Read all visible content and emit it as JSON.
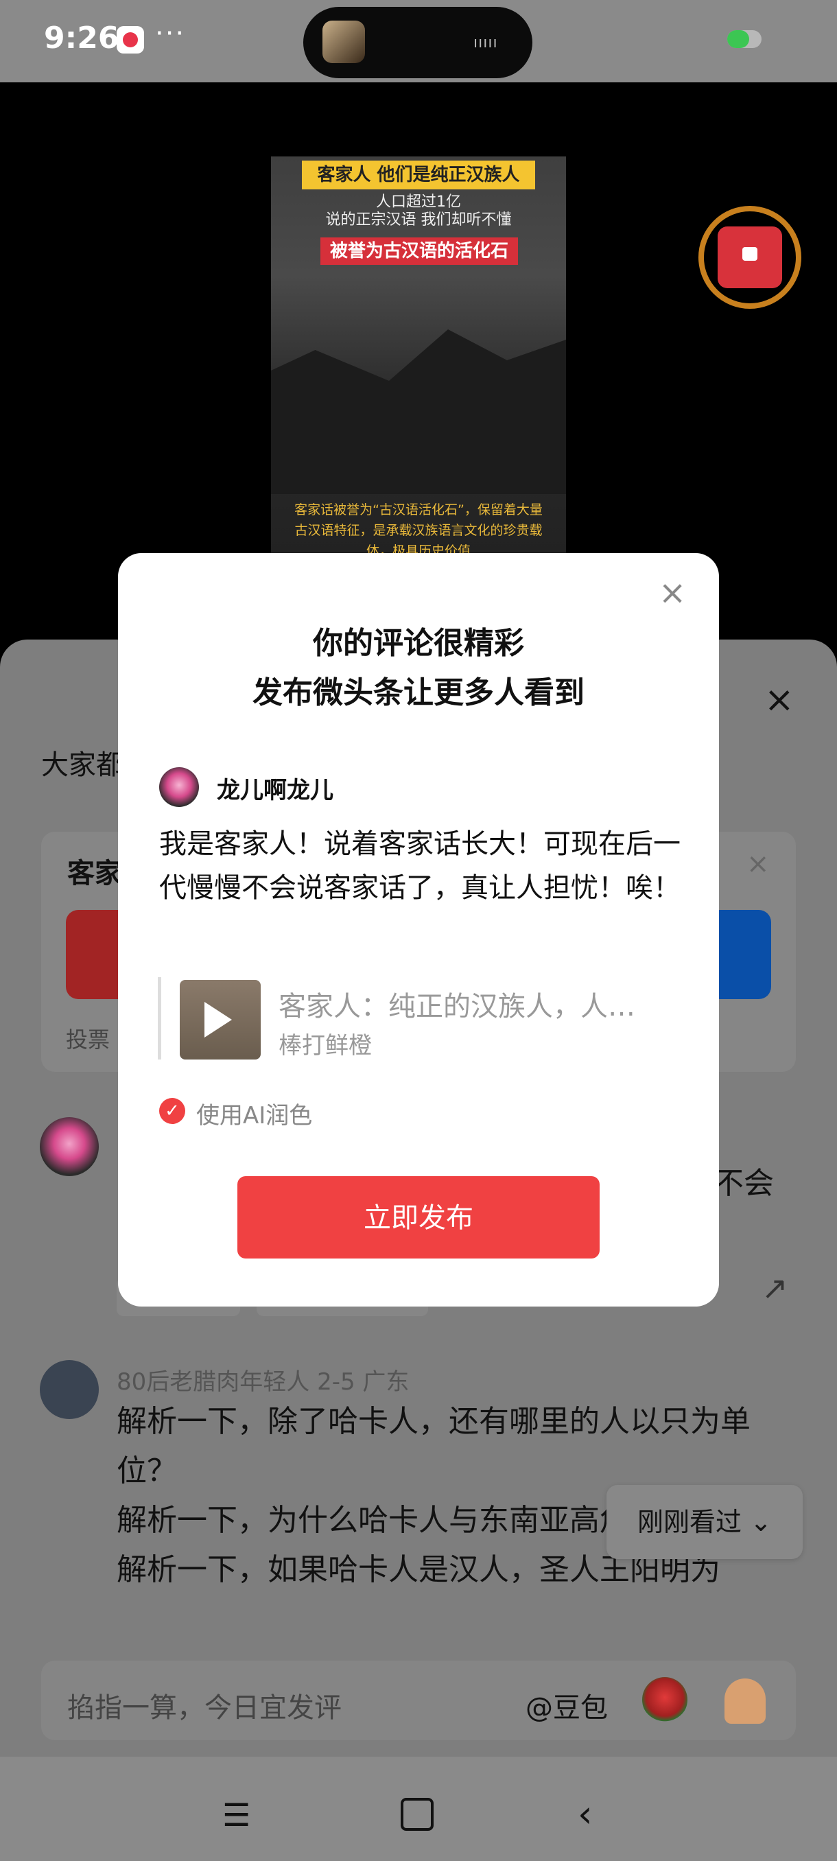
{
  "status_bar": {
    "time": "9:26",
    "more": "···",
    "island_wave": "ııııı"
  },
  "video": {
    "title_badge": "客家人 他们是纯正汉族人",
    "subtitle_line1": "人口超过1亿",
    "subtitle_line2": "说的正宗汉语 我们却听不懂",
    "highlight": "被誉为古汉语的活化石",
    "caption": "客家话被誉为“古汉语活化石”，保留着大量古汉语特征，是承载汉族语言文化的珍贵载体，极具历史价值"
  },
  "sheet": {
    "heading": "大家都",
    "vote_title": "客家",
    "vote_footer": "投票",
    "comment1_tail": "不会",
    "comment2": {
      "meta": "80后老腊肉年轻人  2-5  广东",
      "body": "解析一下，除了哈卡人，还有哪里的人以只为单位？\n解析一下，为什么哈卡人与东南亚高危人群？\n解析一下，如果哈卡人是汉人，圣人王阳明为"
    },
    "recently_viewed": "刚刚看过 ⌄",
    "input_placeholder": "掐指一算，今日宜发评",
    "input_at": "@豆包"
  },
  "modal": {
    "title_line1": "你的评论很精彩",
    "title_line2": "发布微头条让更多人看到",
    "username": "龙儿啊龙儿",
    "comment_text": "我是客家人！说着客家话长大！可现在后一代慢慢不会说客家话了，真让人担忧！唉！",
    "quote_title": "客家人：纯正的汉族人，人…",
    "quote_author": "棒打鲜橙",
    "ai_label": "使用AI润色",
    "publish_label": "立即发布"
  },
  "icons": {
    "close": "×",
    "check": "✓",
    "share": "↗",
    "menu": "☰",
    "back": "‹"
  }
}
